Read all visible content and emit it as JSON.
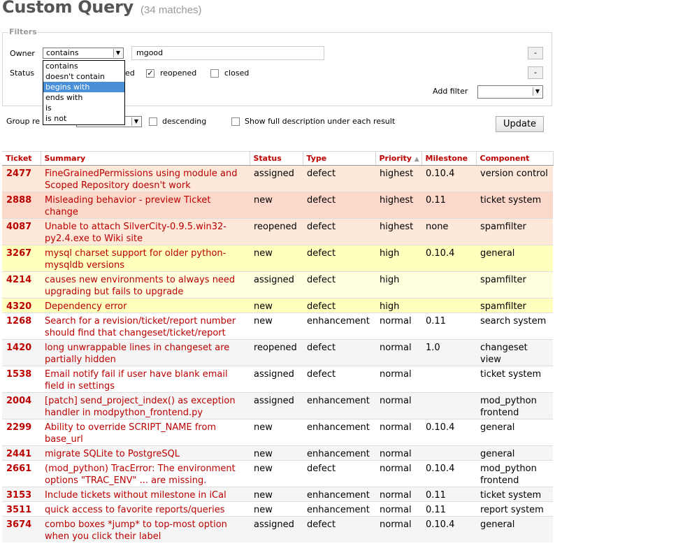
{
  "page": {
    "title": "Custom Query",
    "matches": "(34 matches)"
  },
  "filters": {
    "legend": "Filters",
    "owner_label": "Owner",
    "owner_mode": "contains",
    "owner_value": "mgood",
    "status_label": "Status",
    "status_options": [
      {
        "label": "reopened",
        "checked": true
      },
      {
        "label": "closed",
        "checked": false
      }
    ],
    "status_partial": "ed",
    "remove_label": "-",
    "add_filter_label": "Add filter",
    "add_filter_value": "",
    "dropdown_options": [
      "contains",
      "doesn't contain",
      "begins with",
      "ends with",
      "is",
      "is not"
    ],
    "dropdown_selected": "begins with"
  },
  "options": {
    "group_label_partial": "Group re",
    "group_value": "",
    "descending_label": "descending",
    "full_desc_label": "Show full description under each result",
    "update_label": "Update"
  },
  "table": {
    "headers": [
      "Ticket",
      "Summary",
      "Status",
      "Type",
      "Priority",
      "Milestone",
      "Component"
    ],
    "sort_indicator": "▲",
    "rows": [
      {
        "id": "2477",
        "summary": "FineGrainedPermissions using module and Scoped Repository doesn't work",
        "status": "assigned",
        "type": "defect",
        "priority": "highest",
        "milestone": "0.10.4",
        "component": "version control"
      },
      {
        "id": "2888",
        "summary": "Misleading behavior - preview Ticket change",
        "status": "new",
        "type": "defect",
        "priority": "highest",
        "milestone": "0.11",
        "component": "ticket system"
      },
      {
        "id": "4087",
        "summary": "Unable to attach SilverCity-0.9.5.win32-py2.4.exe to Wiki site",
        "status": "reopened",
        "type": "defect",
        "priority": "highest",
        "milestone": "none",
        "component": "spamfilter"
      },
      {
        "id": "3267",
        "summary": "mysql charset support for older python-mysqldb versions",
        "status": "new",
        "type": "defect",
        "priority": "high",
        "milestone": "0.10.4",
        "component": "general"
      },
      {
        "id": "4214",
        "summary": "causes new environments to always need upgrading but fails to upgrade",
        "status": "assigned",
        "type": "defect",
        "priority": "high",
        "milestone": "",
        "component": "spamfilter"
      },
      {
        "id": "4320",
        "summary": "Dependency error",
        "status": "new",
        "type": "defect",
        "priority": "high",
        "milestone": "",
        "component": "spamfilter"
      },
      {
        "id": "1268",
        "summary": "Search for a revision/ticket/report number should find that changeset/ticket/report",
        "status": "new",
        "type": "enhancement",
        "priority": "normal",
        "milestone": "0.11",
        "component": "search system"
      },
      {
        "id": "1420",
        "summary": "long unwrappable lines in changeset are partially hidden",
        "status": "reopened",
        "type": "defect",
        "priority": "normal",
        "milestone": "1.0",
        "component": "changeset view"
      },
      {
        "id": "1538",
        "summary": "Email notify fail if user have blank email field in settings",
        "status": "assigned",
        "type": "defect",
        "priority": "normal",
        "milestone": "",
        "component": "ticket system"
      },
      {
        "id": "2004",
        "summary": "[patch] send_project_index() as exception handler in modpython_frontend.py",
        "status": "assigned",
        "type": "enhancement",
        "priority": "normal",
        "milestone": "",
        "component": "mod_python frontend"
      },
      {
        "id": "2299",
        "summary": "Ability to override SCRIPT_NAME from base_url",
        "status": "new",
        "type": "enhancement",
        "priority": "normal",
        "milestone": "0.10.4",
        "component": "general"
      },
      {
        "id": "2441",
        "summary": "migrate SQLite to PostgreSQL",
        "status": "new",
        "type": "enhancement",
        "priority": "normal",
        "milestone": "",
        "component": "general"
      },
      {
        "id": "2661",
        "summary": "(mod_python) TracError: The environment options \"TRAC_ENV\" ... are missing.",
        "status": "new",
        "type": "defect",
        "priority": "normal",
        "milestone": "0.10.4",
        "component": "mod_python frontend"
      },
      {
        "id": "3153",
        "summary": "Include tickets without milestone in iCal",
        "status": "new",
        "type": "enhancement",
        "priority": "normal",
        "milestone": "0.11",
        "component": "ticket system"
      },
      {
        "id": "3511",
        "summary": "quick access to favorite reports/queries",
        "status": "new",
        "type": "enhancement",
        "priority": "normal",
        "milestone": "0.11",
        "component": "report system"
      },
      {
        "id": "3674",
        "summary": "combo boxes *jump* to top-most option when you click their label",
        "status": "assigned",
        "type": "defect",
        "priority": "normal",
        "milestone": "0.10.4",
        "component": "general"
      }
    ]
  }
}
